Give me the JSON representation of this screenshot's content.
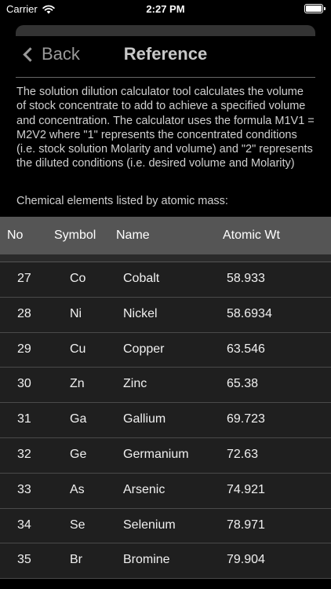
{
  "status_bar": {
    "carrier": "Carrier",
    "time": "2:27 PM"
  },
  "nav": {
    "back_label": "Back",
    "title": "Reference"
  },
  "description": "The solution dilution calculator tool calculates the volume of stock concentrate to add to achieve a specified volume and concentration. The calculator uses the formula M1V1 = M2V2 where \"1\" represents the concentrated conditions (i.e. stock solution Molarity and volume) and \"2\" represents the diluted conditions (i.e. desired volume and Molarity)",
  "subheading": "Chemical elements listed by atomic mass:",
  "table": {
    "headers": {
      "no": "No",
      "symbol": "Symbol",
      "name": "Name",
      "weight": "Atomic Wt"
    },
    "rows": [
      {
        "no": "27",
        "symbol": "Co",
        "name": "Cobalt",
        "weight": "58.933"
      },
      {
        "no": "28",
        "symbol": "Ni",
        "name": "Nickel",
        "weight": "58.6934"
      },
      {
        "no": "29",
        "symbol": "Cu",
        "name": "Copper",
        "weight": "63.546"
      },
      {
        "no": "30",
        "symbol": "Zn",
        "name": "Zinc",
        "weight": "65.38"
      },
      {
        "no": "31",
        "symbol": "Ga",
        "name": "Gallium",
        "weight": "69.723"
      },
      {
        "no": "32",
        "symbol": "Ge",
        "name": "Germanium",
        "weight": "72.63"
      },
      {
        "no": "33",
        "symbol": "As",
        "name": "Arsenic",
        "weight": "74.921"
      },
      {
        "no": "34",
        "symbol": "Se",
        "name": "Selenium",
        "weight": "78.971"
      },
      {
        "no": "35",
        "symbol": "Br",
        "name": "Bromine",
        "weight": "79.904"
      }
    ]
  }
}
